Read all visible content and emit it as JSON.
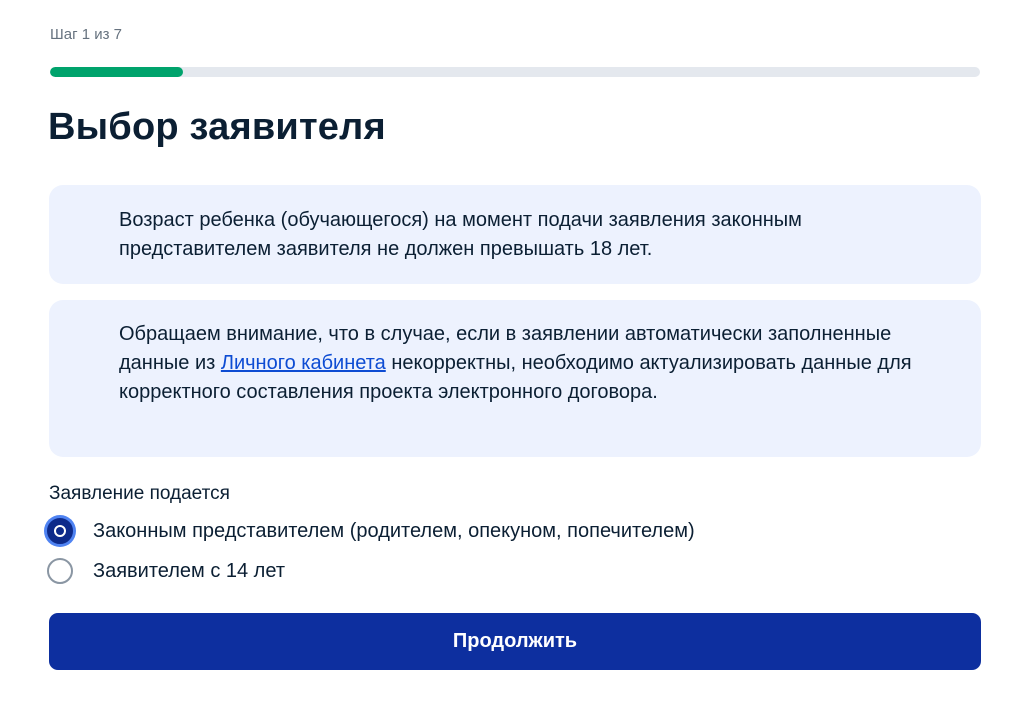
{
  "step": {
    "label": "Шаг 1 из 7",
    "current": 1,
    "total": 7,
    "progress_fraction": 0.143,
    "progress_color": "#00a36c"
  },
  "title": "Выбор заявителя",
  "info_boxes": [
    {
      "icon": "info-icon",
      "text": "Возраст ребенка (обучающегося) на момент подачи заявления законным представителем заявителя не должен превышать 18 лет."
    },
    {
      "icon": "info-icon",
      "text_before_link": "Обращаем внимание, что в случае, если в заявлении автоматически заполненные данные из ",
      "link_text": "Личного кабинета",
      "text_after_link": " некорректны, необходимо актуализировать данные для корректного составления проекта электронного договора."
    }
  ],
  "applicant_group": {
    "label": "Заявление подается",
    "options": [
      {
        "label": "Законным представителем (родителем, опекуном, попечителем)",
        "selected": true
      },
      {
        "label": "Заявителем с 14 лет",
        "selected": false
      }
    ]
  },
  "continue_button": {
    "label": "Продолжить",
    "color": "#0d2f9f"
  },
  "colors": {
    "accent": "#0d2f9f",
    "info_background": "#edf2fe",
    "info_icon": "#2f7df5",
    "link": "#0d4cd3"
  }
}
